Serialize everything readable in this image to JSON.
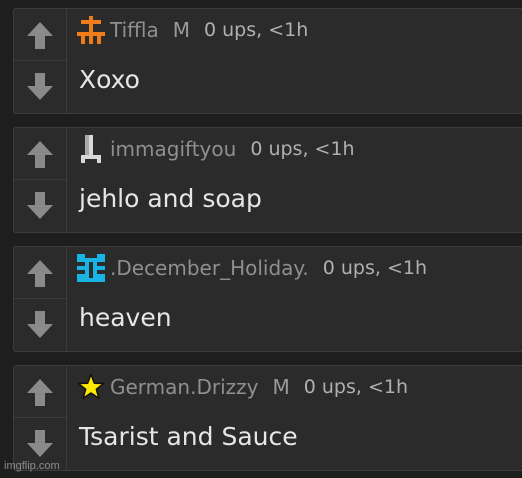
{
  "colors": {
    "background": "#1e1e1e",
    "card": "#2b2b2b",
    "border": "#3c3c3c",
    "username": "#8f8f8f",
    "body_text": "#e6e6e6",
    "arrow": "#8a8a8a",
    "avatar_orange": "#f07d1a",
    "avatar_cyan": "#19b4e6",
    "avatar_star": "#ffe800"
  },
  "comments": [
    {
      "avatar": "orange-pixel-avatar-icon",
      "username": "Tiffla",
      "gender": "M",
      "ups": "0 ups, <1h",
      "text": "Xoxo"
    },
    {
      "avatar": "gray-pixel-avatar-icon",
      "username": "immagiftyou",
      "ups": "0 ups, <1h",
      "text": "jehlo and soap"
    },
    {
      "avatar": "cyan-pixel-avatar-icon",
      "username": ".December_Holiday.",
      "ups": "0 ups, <1h",
      "text": "heaven"
    },
    {
      "avatar": "star-icon",
      "username": "German.Drizzy",
      "gender": "M",
      "ups": "0 ups, <1h",
      "text": "Tsarist and Sauce"
    }
  ],
  "watermark": "imgflip.com"
}
